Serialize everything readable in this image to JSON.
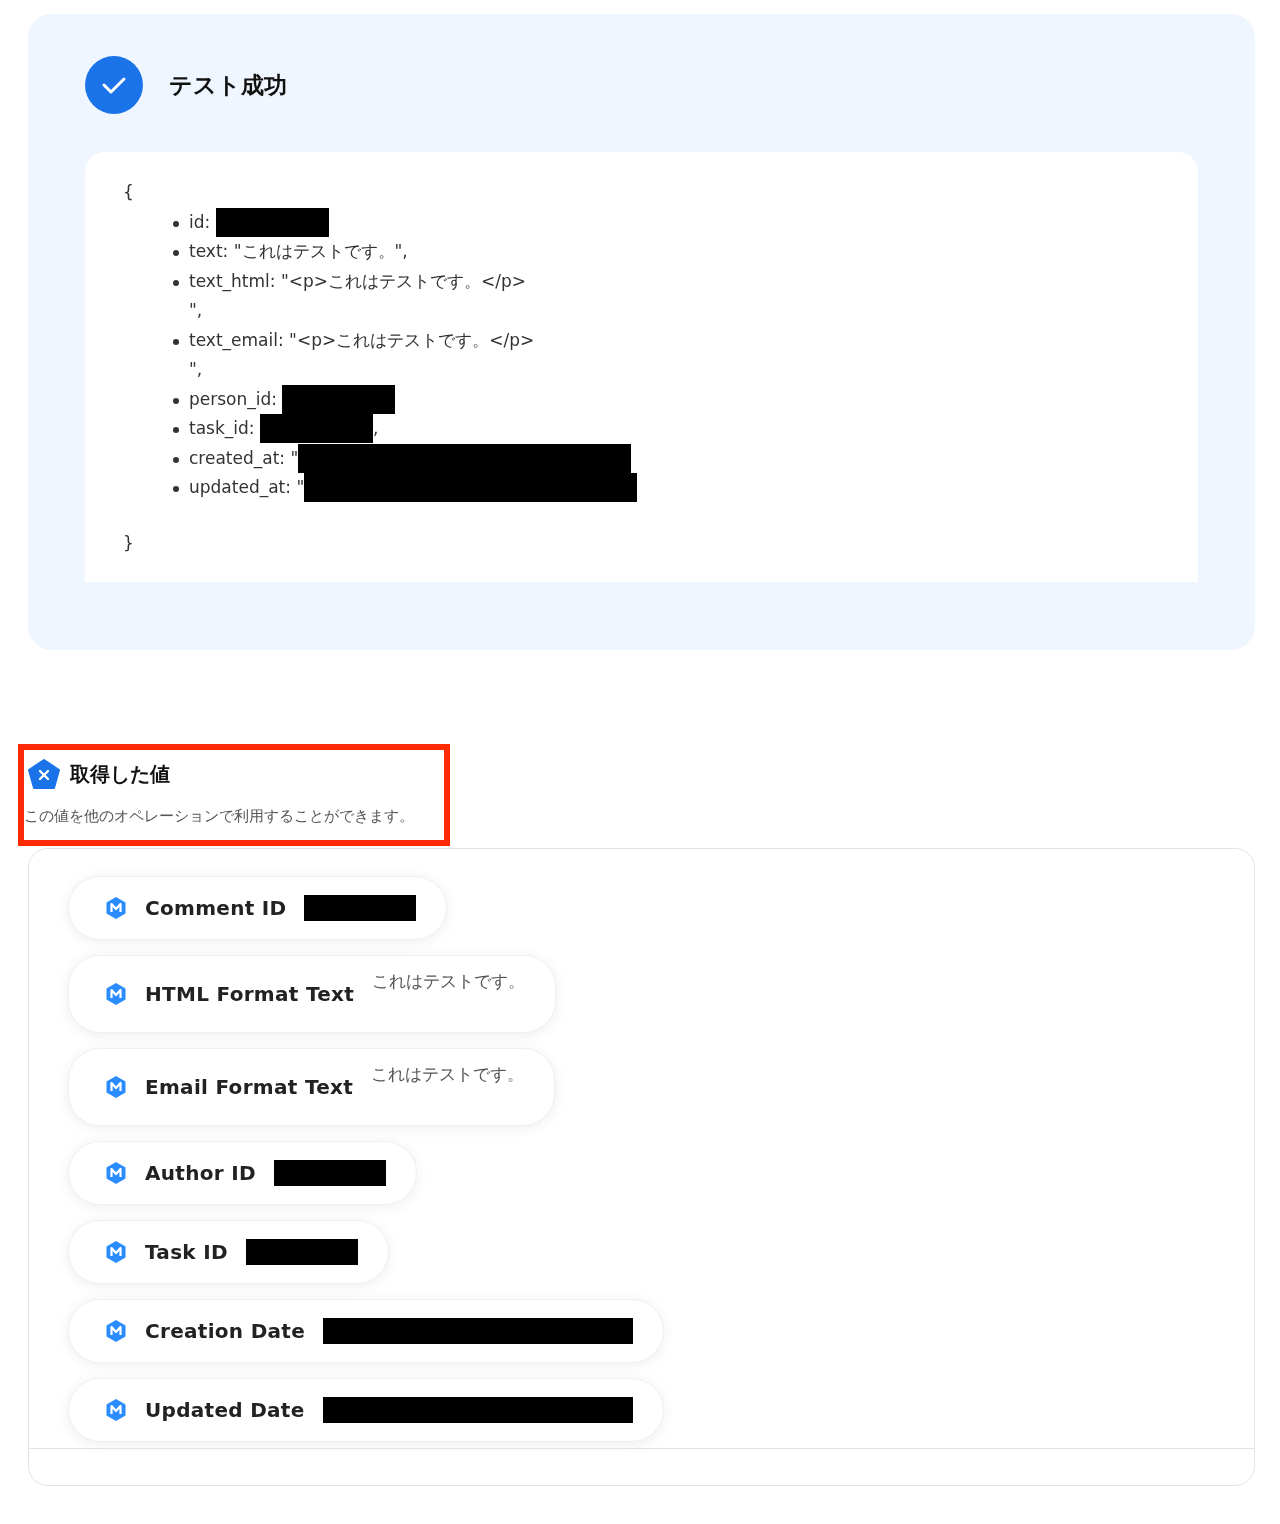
{
  "test_result": {
    "succeeded": true,
    "title": "テスト成功",
    "open_brace": "{",
    "lines": [
      {
        "text": "id: ",
        "redacted": true,
        "wide": false
      },
      {
        "text": "text: \"これはテストです。\","
      },
      {
        "text": "text_html: \"<p>これはテストです。</p>\n\","
      },
      {
        "text": "text_email: \"<p>これはテストです。</p>\n\","
      },
      {
        "text": "person_id: ",
        "redacted": true,
        "wide": false
      },
      {
        "text": "task_id: ",
        "redacted": true,
        "wide": false,
        "after": ","
      },
      {
        "text": "created_at: \"",
        "redacted": true,
        "wide": true
      },
      {
        "text": "updated_at: \"",
        "redacted": true,
        "wide": true
      }
    ],
    "close_brace": "}"
  },
  "values_section": {
    "title": "取得した値",
    "description": "この値を他のオペレーションで利用することができます。",
    "highlighted": true,
    "fields": [
      {
        "label": "Comment ID",
        "redacted": true,
        "wide": false
      },
      {
        "label": "HTML Format Text",
        "value": "これはテストです。"
      },
      {
        "label": "Email Format Text",
        "value": "これはテストです。"
      },
      {
        "label": "Author ID",
        "redacted": true,
        "wide": false
      },
      {
        "label": "Task ID",
        "redacted": true,
        "wide": false
      },
      {
        "label": "Creation Date",
        "redacted": true,
        "wide": true
      },
      {
        "label": "Updated Date",
        "redacted": true,
        "wide": true
      }
    ]
  }
}
